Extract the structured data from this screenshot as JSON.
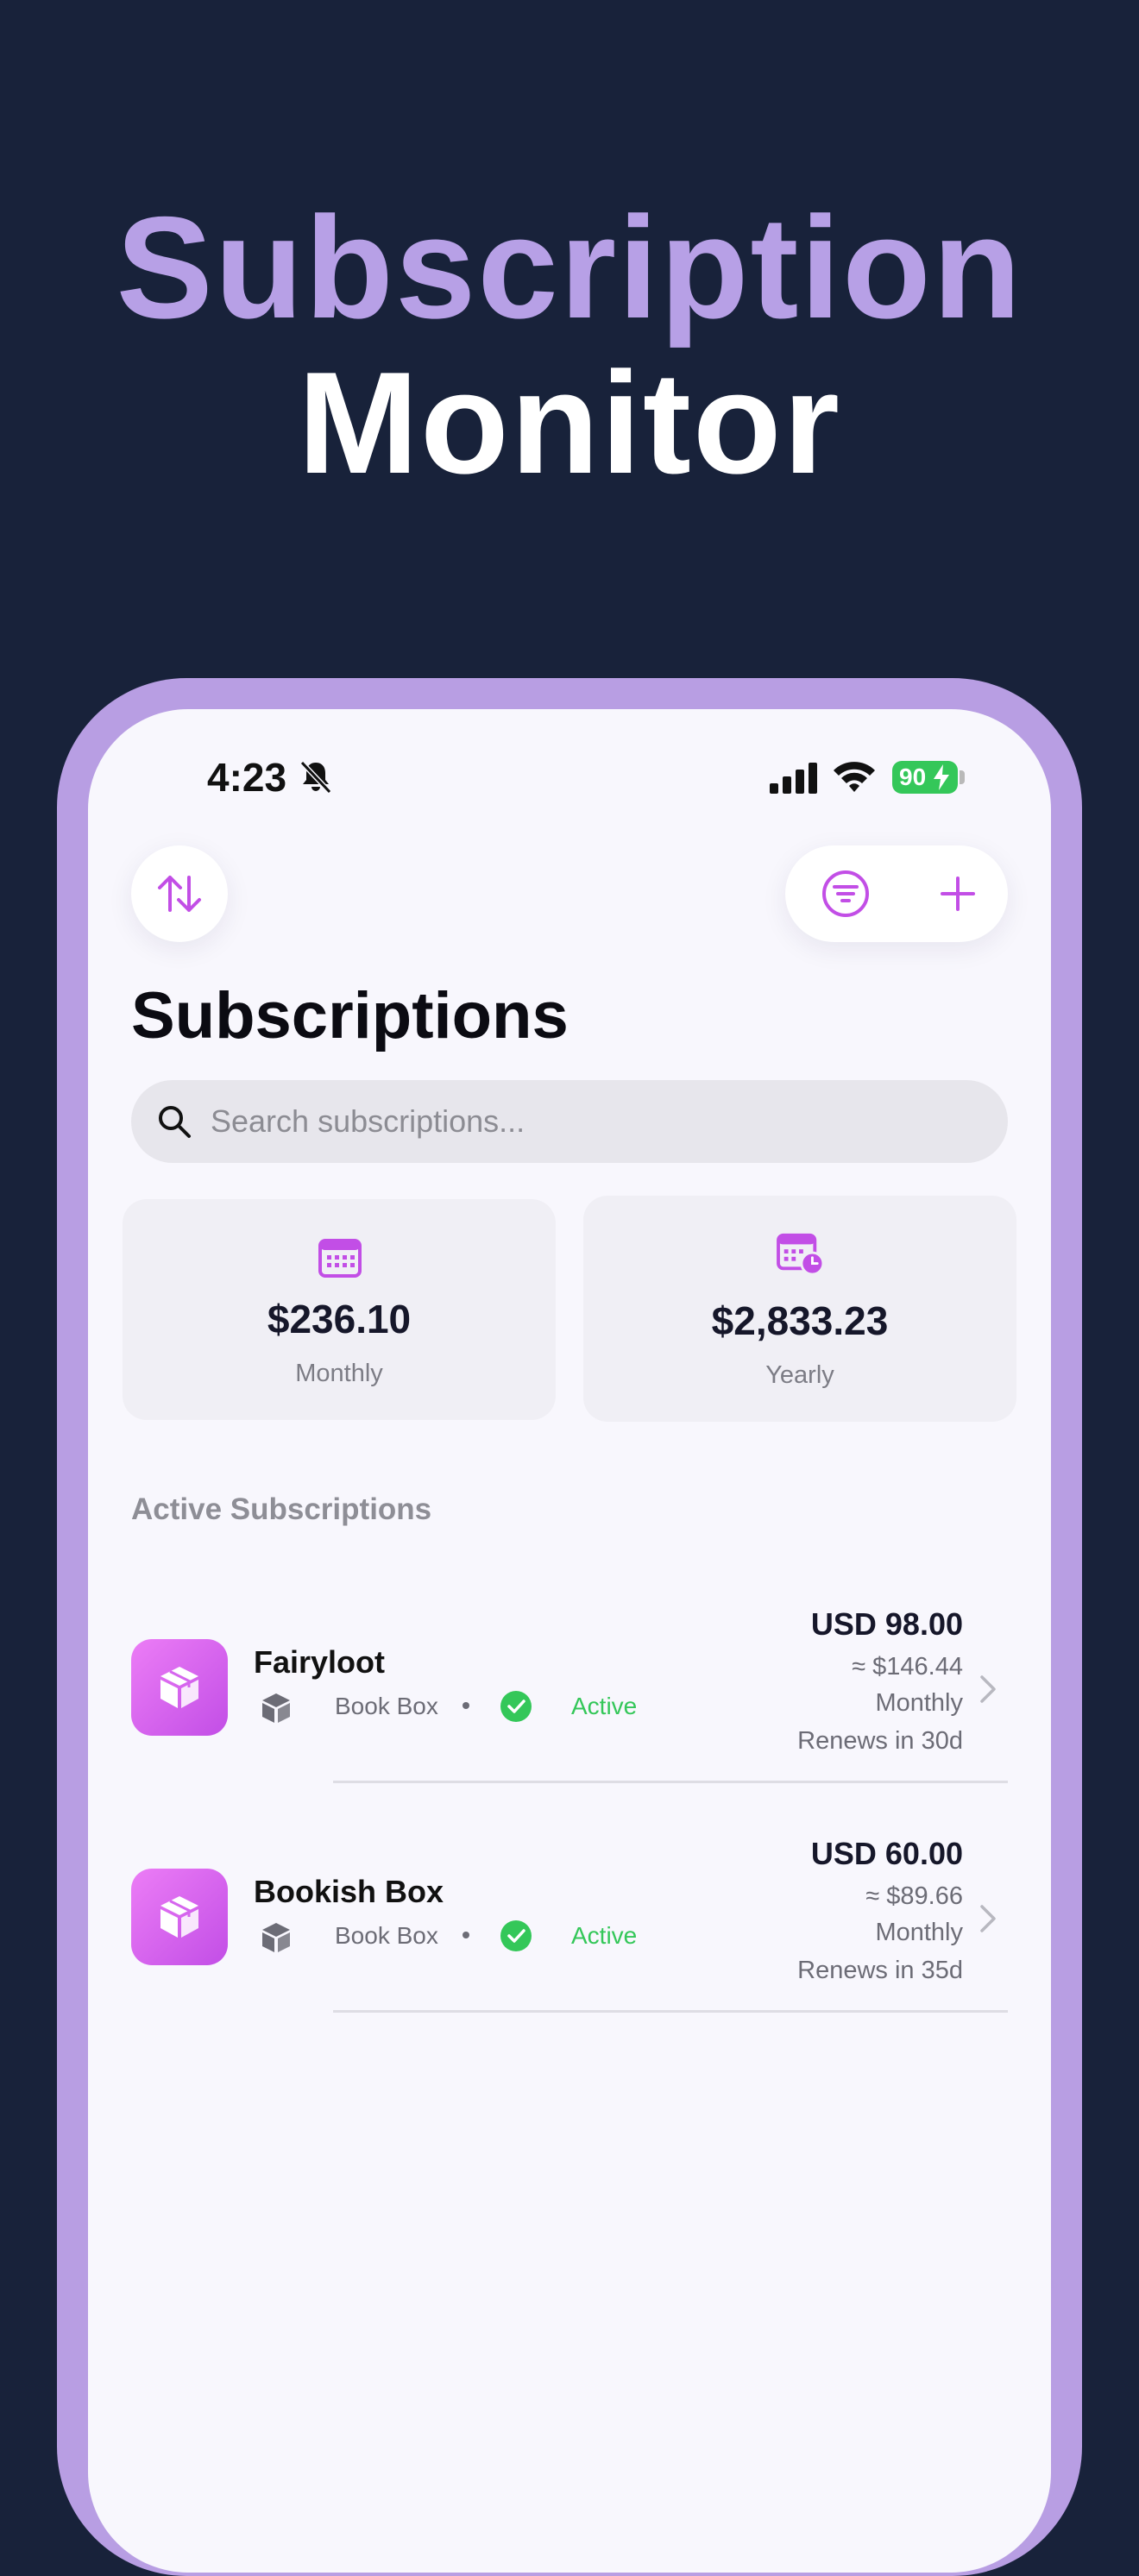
{
  "hero": {
    "line1": "Subscription",
    "line2": "Monitor"
  },
  "status_bar": {
    "time": "4:23",
    "battery": "90"
  },
  "header": {
    "title": "Subscriptions"
  },
  "search": {
    "placeholder": "Search subscriptions..."
  },
  "summary": {
    "monthly_amount": "$236.10",
    "monthly_label": "Monthly",
    "yearly_amount": "$2,833.23",
    "yearly_label": "Yearly"
  },
  "section": {
    "title": "Active Subscriptions"
  },
  "subscriptions": [
    {
      "name": "Fairyloot",
      "category": "Book Box",
      "status": "Active",
      "price": "USD 98.00",
      "approx": "≈ $146.44",
      "cycle": "Monthly",
      "renewal": "Renews in 30d"
    },
    {
      "name": "Bookish Box",
      "category": "Book Box",
      "status": "Active",
      "price": "USD 60.00",
      "approx": "≈ $89.66",
      "cycle": "Monthly",
      "renewal": "Renews in 35d"
    }
  ],
  "colors": {
    "background": "#18223a",
    "accent": "#b89ee3",
    "brand_purple": "#c24ee6",
    "status_green": "#34c759"
  },
  "icons": {
    "sort": "arrow-up-down-icon",
    "filter": "filter-icon",
    "add": "plus-icon",
    "search": "search-icon",
    "monthly": "calendar-icon",
    "yearly": "calendar-clock-icon",
    "app": "box-icon",
    "category": "cube-icon",
    "status": "check-circle-icon",
    "chevron": "chevron-right-icon"
  }
}
